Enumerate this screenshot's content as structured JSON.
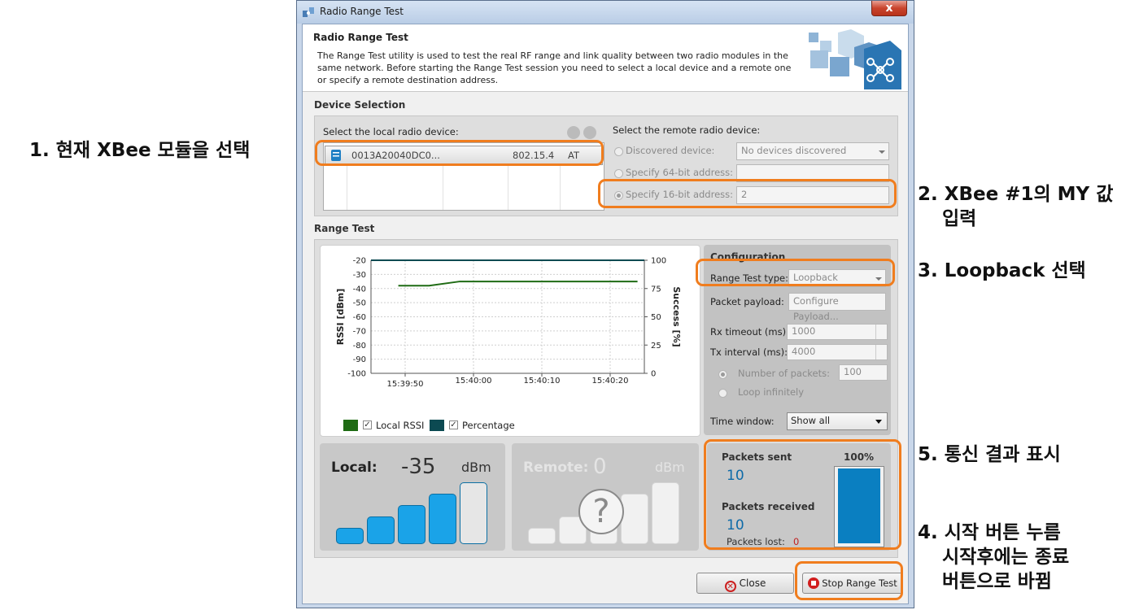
{
  "window": {
    "title": "Radio Range Test",
    "close_glyph": "x"
  },
  "header": {
    "title": "Radio Range Test",
    "description": "The Range Test utility is used to test the real RF range and link quality between two radio modules in the same network. Before starting the Range Test session you need to select a local device and a remote one or specify a remote destination address."
  },
  "device_selection": {
    "section_label": "Device Selection",
    "local_label": "Select the local radio device:",
    "local_devices": [
      {
        "address": "0013A20040DC0...",
        "protocol": "802.15.4",
        "mode": "AT"
      }
    ],
    "remote_label": "Select the remote radio device:",
    "discovered_label": "Discovered device:",
    "discovered_value": "No devices discovered",
    "specify64_label": "Specify 64-bit address:",
    "specify64_value": "",
    "specify16_label": "Specify 16-bit address:",
    "specify16_value": "2"
  },
  "range_test": {
    "section_label": "Range Test",
    "chart": {
      "left_axis_label": "RSSI [dBm]",
      "right_axis_label": "Success [%]"
    },
    "legend": {
      "local_rssi": "Local RSSI",
      "percentage": "Percentage"
    },
    "configuration": {
      "title": "Configuration",
      "type_label": "Range Test type:",
      "type_value": "Loopback",
      "payload_label": "Packet payload:",
      "payload_button": "Configure Payload...",
      "rx_label": "Rx timeout (ms):",
      "rx_value": "1000",
      "tx_label": "Tx interval (ms):",
      "tx_value": "4000",
      "packets_label": "Number of packets:",
      "packets_value": "100",
      "loop_label": "Loop infinitely",
      "window_label": "Time window:",
      "window_value": "Show all"
    },
    "local": {
      "label": "Local:",
      "value": "-35",
      "unit": "dBm",
      "signal_level": 4,
      "signal_max": 5
    },
    "remote": {
      "label": "Remote:",
      "value": "0",
      "unit": "dBm",
      "unknown_glyph": "?"
    },
    "results": {
      "sent_label": "Packets sent",
      "sent_value": "10",
      "received_label": "Packets received",
      "received_value": "10",
      "lost_label": "Packets lost:",
      "lost_value": "0",
      "percent": "100%",
      "percent_value": 100
    }
  },
  "buttons": {
    "close": "Close",
    "stop": "Stop Range Test"
  },
  "annotations": {
    "a1": "1. 현재 XBee 모듈을 선택",
    "a2_line1": "2. XBee #1의 MY 값",
    "a2_line2": "입력",
    "a3": "3. Loopback 선택",
    "a5": "5. 통신 결과 표시",
    "a4_line1": "4. 시작 버튼 누름",
    "a4_line2": "시작후에는 종료",
    "a4_line3": "버튼으로 바뀜"
  },
  "chart_data": {
    "type": "line",
    "title": "",
    "xlabel": "",
    "ylabel": "RSSI [dBm]",
    "y2label": "Success [%]",
    "ylim": [
      -100,
      -20
    ],
    "y2lim": [
      0,
      100
    ],
    "yticks": [
      -20,
      -30,
      -40,
      -50,
      -60,
      -70,
      -80,
      -90,
      -100
    ],
    "y2ticks": [
      100,
      75,
      50,
      25,
      0
    ],
    "x_ticks": [
      "15:39:50",
      "15:40:00",
      "15:40:10",
      "15:40:20"
    ],
    "x_tick_seconds": [
      5,
      15,
      25,
      35
    ],
    "xlim_seconds": [
      0,
      40
    ],
    "grid": true,
    "legend": "bottom",
    "colors": {
      "Local RSSI": "#1f6b14",
      "Percentage": "#0c4a52"
    },
    "series": [
      {
        "name": "Local RSSI",
        "axis": "left",
        "x_seconds": [
          4,
          8.5,
          13,
          39
        ],
        "values": [
          -38,
          -38,
          -35,
          -35
        ]
      },
      {
        "name": "Percentage",
        "axis": "right",
        "x_seconds": [
          0,
          40
        ],
        "values": [
          100,
          100
        ]
      }
    ]
  }
}
